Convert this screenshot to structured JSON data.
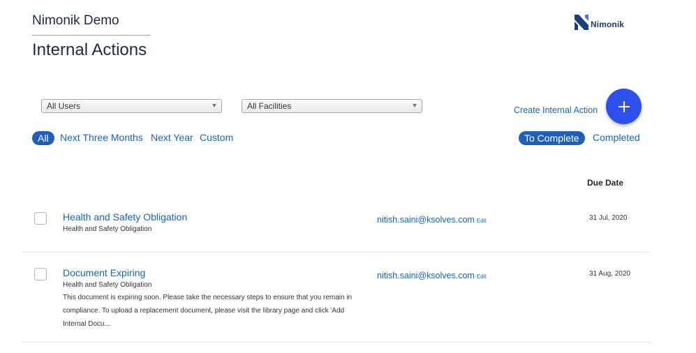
{
  "header": {
    "org_name": "Nimonik Demo",
    "page_title": "Internal Actions",
    "logo_text": "Nimonik"
  },
  "filters": {
    "user_select": "All Users",
    "facility_select": "All Facilities",
    "time_ranges": [
      "All",
      "Next Three Months",
      "Next Year",
      "Custom"
    ],
    "active_time_range": "All"
  },
  "actions": {
    "create_label": "Create Internal Action",
    "fab_icon": "plus-icon"
  },
  "status_tabs": {
    "to_complete": "To Complete",
    "completed": "Completed",
    "active": "To Complete"
  },
  "table": {
    "due_date_header": "Due Date",
    "rows": [
      {
        "title": "Health and Safety Obligation",
        "subtitle": "Health and Safety Obligation",
        "description": "",
        "assignee": "nitish.saini@ksolves.com",
        "edit_label": "Edit",
        "due_date": "31 Jul, 2020"
      },
      {
        "title": "Document Expiring",
        "subtitle": "Health and Safety Obligation",
        "description": "This document is expiring soon. Please take the necessary steps to ensure that you remain in compliance. To upload a replacement document, please visit the library page and click 'Add Internal Docu...",
        "assignee": "nitish.saini@ksolves.com",
        "edit_label": "Edit",
        "due_date": "31 Aug, 2020"
      }
    ]
  },
  "colors": {
    "accent": "#1565c0",
    "pill": "#1e5fb8",
    "fab": "#2b50ec",
    "logo": "#1b3f7a"
  }
}
